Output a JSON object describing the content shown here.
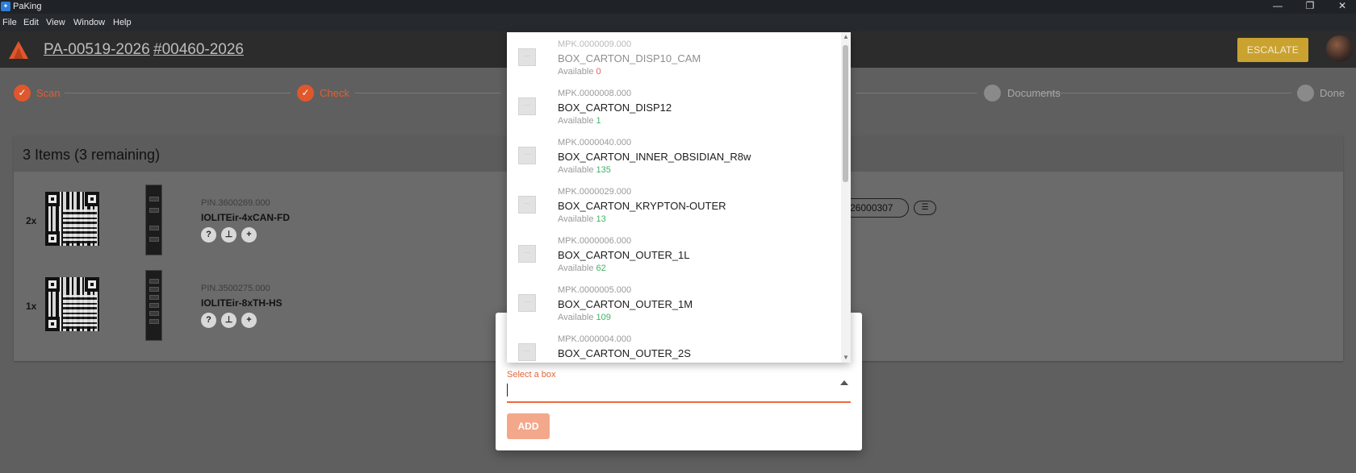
{
  "window": {
    "title": "PaKing",
    "app_icon": "app-logo-icon",
    "controls": [
      "minimize-icon",
      "restore-icon",
      "close-icon"
    ]
  },
  "menu": [
    "File",
    "Edit",
    "View",
    "Window",
    "Help"
  ],
  "header": {
    "order_ref": "PA-00519-2026",
    "order_number": "#00460-2026",
    "escalate_label": "ESCALATE",
    "accent_color": "#e0572c",
    "escalate_color": "#caa230"
  },
  "stepper": {
    "steps": [
      {
        "label": "Scan",
        "state": "done"
      },
      {
        "label": "Check",
        "state": "done"
      },
      {
        "label": "Documents",
        "state": "todo"
      },
      {
        "label": "Done",
        "state": "todo"
      }
    ]
  },
  "items": {
    "title": "3 Items (3 remaining)",
    "rows": [
      {
        "qty": "2x",
        "pin": "PIN.3600269.000",
        "name": "IOLITEir-4xCAN-FD"
      },
      {
        "qty": "1x",
        "pin": "PIN.3500275.000",
        "name": "IOLITEir-8xTH-HS"
      }
    ],
    "serial_partial": "26000307"
  },
  "dialog": {
    "select_label": "Select a box",
    "select_value": "",
    "add_label": "ADD"
  },
  "dropdown": {
    "available_prefix": "Available",
    "options": [
      {
        "code": "MPK.0000009.000",
        "name": "BOX_CARTON_DISP10_CAM",
        "available": "0"
      },
      {
        "code": "MPK.0000008.000",
        "name": "BOX_CARTON_DISP12",
        "available": "1"
      },
      {
        "code": "MPK.0000040.000",
        "name": "BOX_CARTON_INNER_OBSIDIAN_R8w",
        "available": "135"
      },
      {
        "code": "MPK.0000029.000",
        "name": "BOX_CARTON_KRYPTON-OUTER",
        "available": "13"
      },
      {
        "code": "MPK.0000006.000",
        "name": "BOX_CARTON_OUTER_1L",
        "available": "62"
      },
      {
        "code": "MPK.0000005.000",
        "name": "BOX_CARTON_OUTER_1M",
        "available": "109"
      },
      {
        "code": "MPK.0000004.000",
        "name": "BOX_CARTON_OUTER_2S",
        "available": ""
      }
    ]
  }
}
